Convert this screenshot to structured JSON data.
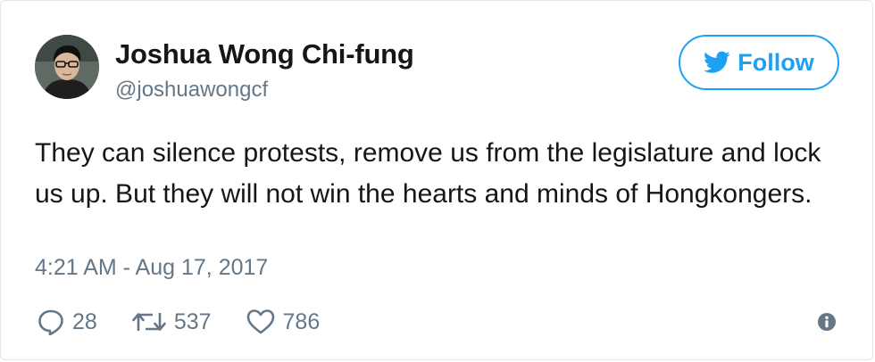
{
  "tweet": {
    "author": {
      "name": "Joshua Wong Chi-fung",
      "handle": "@joshuawongcf",
      "avatar_icon": "profile-photo"
    },
    "follow_label": "Follow",
    "follow_icon": "twitter-bird-icon",
    "text": "They can silence protests, remove us from the legislature and lock us up. But they will not win the hearts and minds of Hongkongers.",
    "timestamp": "4:21 AM - Aug 17, 2017",
    "actions": {
      "replies": "28",
      "retweets": "537",
      "likes": "786"
    },
    "info_icon": "info-icon"
  },
  "colors": {
    "accent": "#1da1f2",
    "text_primary": "#14171a",
    "text_secondary": "#657786",
    "border": "#e1e8ed"
  }
}
